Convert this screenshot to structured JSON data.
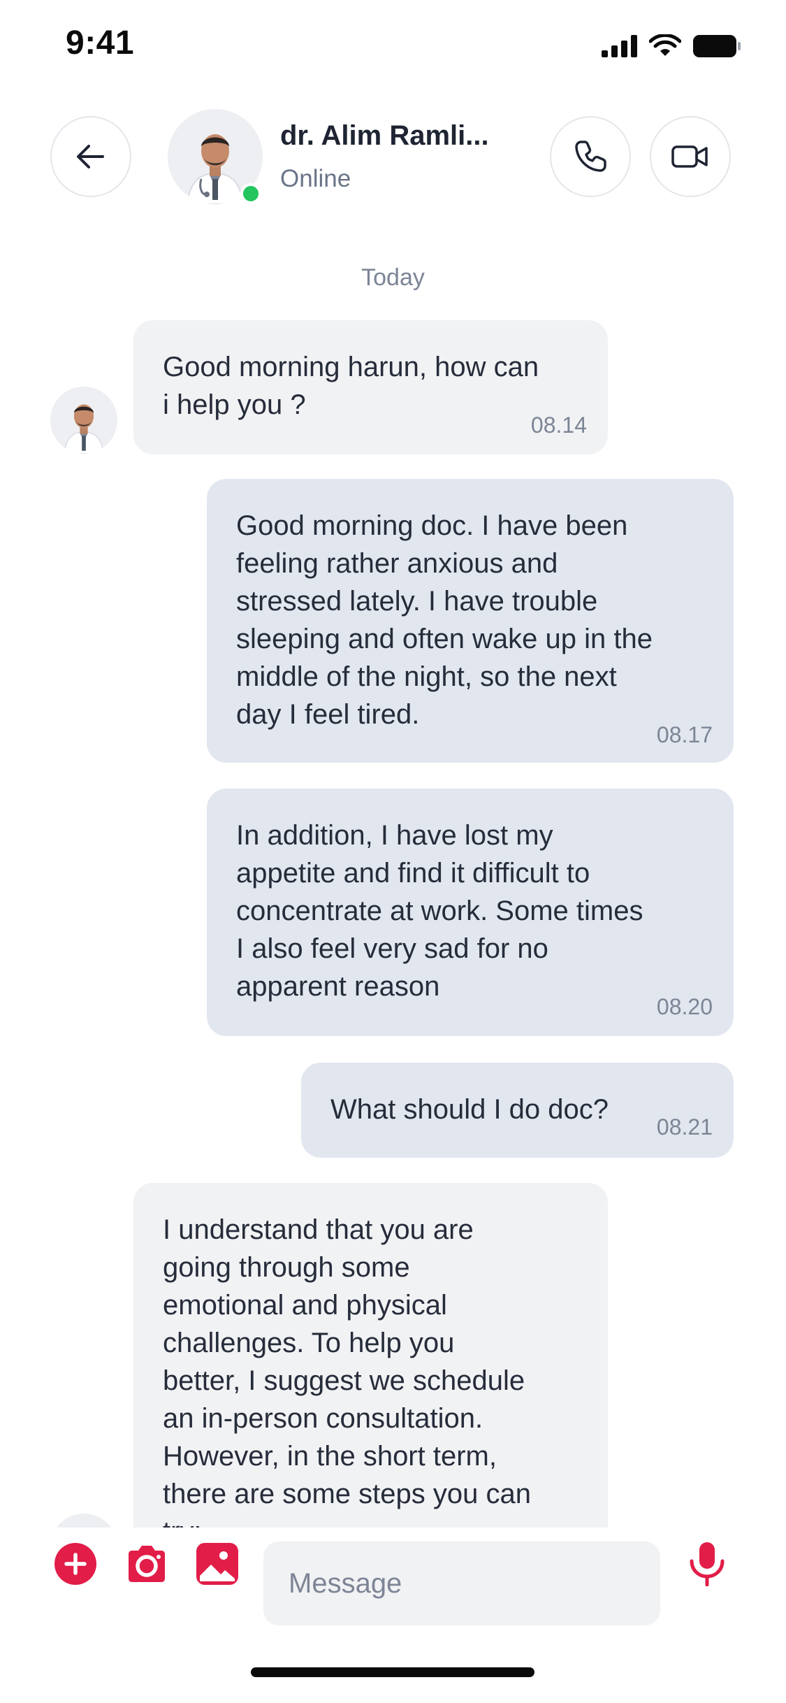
{
  "status_bar": {
    "time": "9:41"
  },
  "header": {
    "contact_name": "dr. Alim Ramli...",
    "contact_status": "Online"
  },
  "conversation": {
    "day_label": "Today",
    "messages": [
      {
        "direction": "incoming",
        "text": "Good morning harun, how can\ni help you ?",
        "time": "08.14"
      },
      {
        "direction": "outgoing",
        "text": "Good morning doc. I have been\nfeeling rather anxious and\nstressed lately. I have trouble\nsleeping and often wake up in the\nmiddle of the night, so the next\nday I feel tired.",
        "time": "08.17"
      },
      {
        "direction": "outgoing",
        "text": "In addition, I have lost my\nappetite and find it difficult to\nconcentrate at work. Some times\nI also feel very sad for no\napparent reason",
        "time": "08.20"
      },
      {
        "direction": "outgoing",
        "text": "What should I do doc?",
        "time": "08.21"
      },
      {
        "direction": "incoming",
        "text": "I understand that you are\ngoing through some\nemotional and physical\nchallenges. To help you\nbetter, I suggest we schedule\nan in-person consultation.\nHowever, in the short term,\nthere are some steps you can\ntry:",
        "time": ""
      }
    ]
  },
  "composer": {
    "placeholder": "Message"
  },
  "colors": {
    "accent": "#e11d48",
    "online": "#22c55e",
    "incoming_bubble": "#f1f2f4",
    "outgoing_bubble": "#e2e7ef"
  },
  "icons": {
    "back": "arrow-left-icon",
    "call": "phone-icon",
    "video": "video-camera-icon",
    "add": "plus-circle-icon",
    "camera": "camera-icon",
    "gallery": "image-icon",
    "mic": "microphone-icon"
  }
}
